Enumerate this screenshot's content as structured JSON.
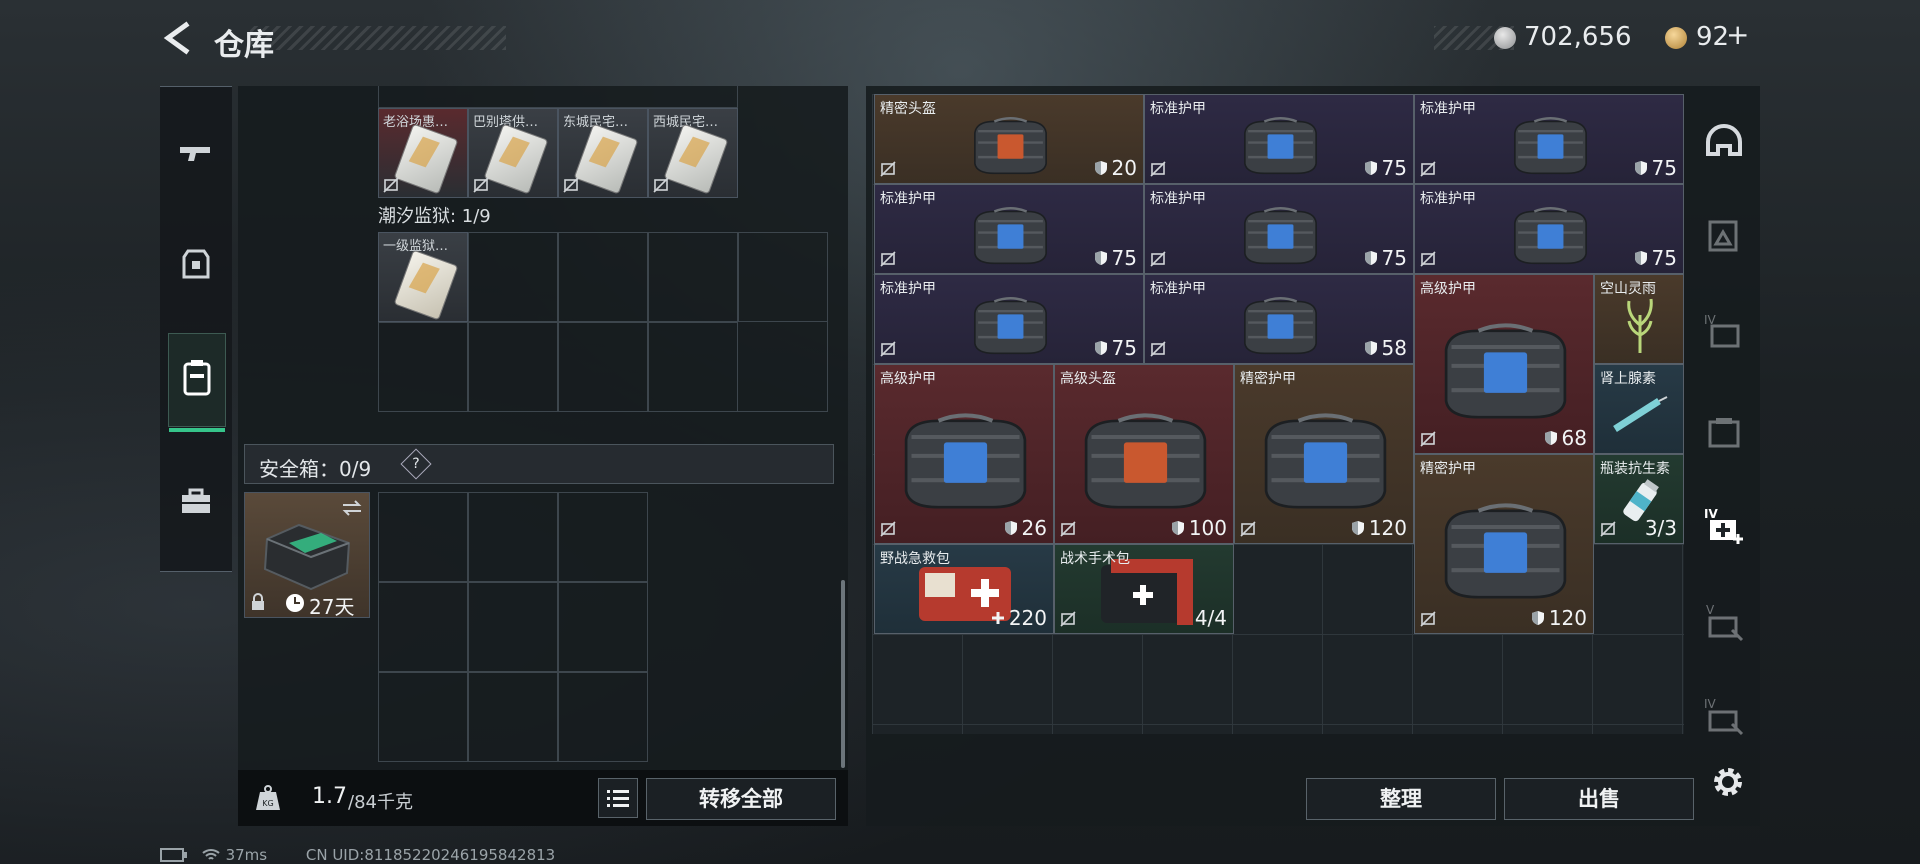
{
  "header": {
    "title": "仓库",
    "currency1": "702,656",
    "currency2": "92",
    "plus": "+"
  },
  "left": {
    "top_items": [
      "老浴场惠…",
      "巴别塔供…",
      "东城民宅…",
      "西城民宅…"
    ],
    "prison_section": "潮汐监狱: 1/9",
    "prison_items": [
      "一级监狱…"
    ],
    "safe_label": "安全箱：0/9",
    "help": "?",
    "safe_timer": "27天",
    "weight_value": "1.7",
    "weight_total": "/84千克",
    "kg_label": "KG",
    "transfer_all": "转移全部"
  },
  "right": {
    "items": [
      {
        "name": "精密头盔",
        "value": "20",
        "color": "gold",
        "kind": "helmet"
      },
      {
        "name": "标准护甲",
        "value": "75",
        "color": "purple",
        "kind": "vest"
      },
      {
        "name": "标准护甲",
        "value": "75",
        "color": "purple",
        "kind": "vest"
      },
      {
        "name": "标准护甲",
        "value": "75",
        "color": "purple",
        "kind": "vest"
      },
      {
        "name": "标准护甲",
        "value": "75",
        "color": "purple",
        "kind": "vest"
      },
      {
        "name": "标准护甲",
        "value": "75",
        "color": "purple",
        "kind": "vest"
      },
      {
        "name": "标准护甲",
        "value": "75",
        "color": "purple",
        "kind": "vest"
      },
      {
        "name": "标准护甲",
        "value": "58",
        "color": "purple",
        "kind": "vest"
      },
      {
        "name": "高级护甲",
        "value": "68",
        "color": "red",
        "kind": "vest"
      },
      {
        "name": "空山灵雨",
        "value": "",
        "color": "gold",
        "kind": "plant"
      },
      {
        "name": "高级护甲",
        "value": "26",
        "color": "red",
        "kind": "vest"
      },
      {
        "name": "高级头盔",
        "value": "100",
        "color": "red",
        "kind": "helmet"
      },
      {
        "name": "精密护甲",
        "value": "120",
        "color": "gold",
        "kind": "vest"
      },
      {
        "name": "肾上腺素",
        "value": "",
        "color": "blue",
        "kind": "syringe"
      },
      {
        "name": "精密护甲",
        "value": "120",
        "color": "gold",
        "kind": "vest"
      },
      {
        "name": "瓶装抗生素",
        "value": "3/3",
        "color": "green",
        "kind": "bottle"
      },
      {
        "name": "野战急救包",
        "value": "220",
        "color": "blue",
        "kind": "medkit"
      },
      {
        "name": "战术手术包",
        "value": "4/4",
        "color": "green",
        "kind": "surgkit"
      }
    ],
    "sort_button": "整理",
    "sell_button": "出售"
  },
  "status": {
    "ping": "37ms",
    "uid": "CN UID:8118522024619584281​3"
  },
  "colors": {
    "accent_green": "#36c48a",
    "purple": "#2e2a44",
    "gold": "#4a3a2b",
    "red": "#5a2a2e",
    "blue": "#273a46",
    "green": "#233a30"
  },
  "icons": [
    "back-arrow-icon",
    "silver-coin-icon",
    "gold-coin-icon",
    "gun-icon",
    "armor-icon",
    "backpack-icon",
    "toolbox-icon",
    "helmet-icon",
    "armor-tag-icon",
    "iv-armor-icon",
    "iv-medkit-icon",
    "v-repair-icon",
    "iv-repair-icon",
    "gear-icon",
    "shield-icon",
    "no-drop-icon",
    "swap-icon",
    "lock-icon",
    "clock-icon",
    "list-icon",
    "kg-icon",
    "battery-icon",
    "wifi-icon"
  ]
}
